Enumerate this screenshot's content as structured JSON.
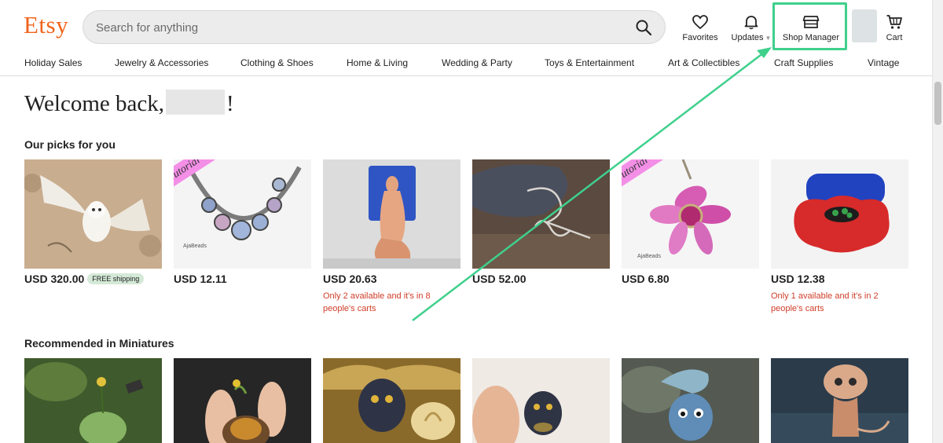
{
  "header": {
    "logo": "Etsy",
    "search_placeholder": "Search for anything",
    "favorites_label": "Favorites",
    "updates_label": "Updates",
    "shop_manager_label": "Shop Manager",
    "cart_label": "Cart"
  },
  "nav": {
    "items": [
      "Holiday Sales",
      "Jewelry & Accessories",
      "Clothing & Shoes",
      "Home & Living",
      "Wedding & Party",
      "Toys & Entertainment",
      "Art & Collectibles",
      "Craft Supplies",
      "Vintage"
    ]
  },
  "welcome": {
    "prefix": "Welcome back,",
    "suffix": "!"
  },
  "picks": {
    "title": "Our picks for you",
    "items": [
      {
        "price": "USD 320.00",
        "badge": "FREE shipping",
        "note": "",
        "image": "owl-embroidery"
      },
      {
        "price": "USD 12.11",
        "badge": "",
        "note": "",
        "image": "beaded-necklace",
        "ribbon": "Tutorial",
        "watermark": "AjaBeads"
      },
      {
        "price": "USD 20.63",
        "badge": "",
        "note": "Only 2 available and it's in 8 people's carts",
        "image": "figure-mold"
      },
      {
        "price": "USD 52.00",
        "badge": "",
        "note": "",
        "image": "wire-brooch"
      },
      {
        "price": "USD 6.80",
        "badge": "",
        "note": "",
        "image": "beaded-pendant",
        "ribbon": "Tutorial",
        "watermark": "AjaBeads"
      },
      {
        "price": "USD 12.38",
        "badge": "",
        "note": "Only 1 available and it's in 2 people's carts",
        "image": "poppy-mold"
      }
    ]
  },
  "miniatures": {
    "title": "Recommended in Miniatures",
    "images": [
      "frog-miniature",
      "hand-held-miniature",
      "beetle-miniature",
      "beetle-in-hand",
      "blue-creature",
      "mouse-creature"
    ]
  },
  "colors": {
    "brand": "#f1641e",
    "highlight": "#3fd08c",
    "scarcity": "#d03d28"
  }
}
